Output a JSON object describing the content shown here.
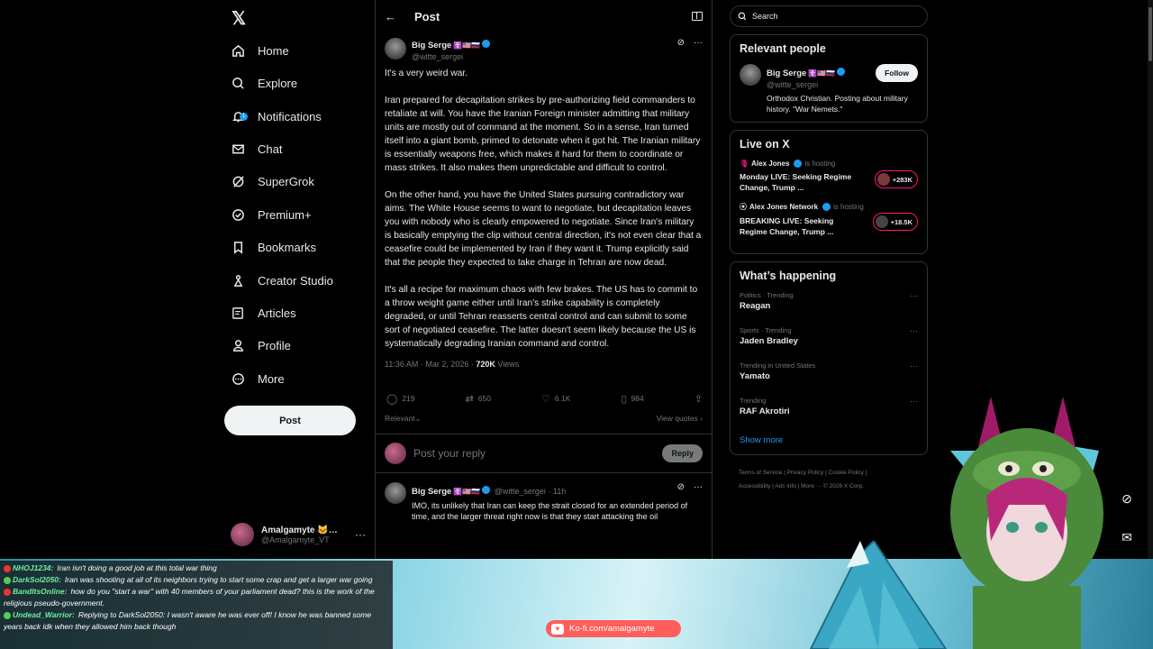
{
  "nav": {
    "logo": "𝕏",
    "items": [
      {
        "label": "Home",
        "icon": "home-icon"
      },
      {
        "label": "Explore",
        "icon": "search-icon"
      },
      {
        "label": "Notifications",
        "icon": "bell-icon"
      },
      {
        "label": "Chat",
        "icon": "mail-icon"
      },
      {
        "label": "SuperGrok",
        "icon": "grok-icon"
      },
      {
        "label": "Premium+",
        "icon": "premium-icon"
      },
      {
        "label": "Bookmarks",
        "icon": "bookmark-icon"
      },
      {
        "label": "Creator Studio",
        "icon": "creator-icon"
      },
      {
        "label": "Articles",
        "icon": "articles-icon"
      },
      {
        "label": "Profile",
        "icon": "person-icon"
      },
      {
        "label": "More",
        "icon": "more-circle-icon"
      }
    ],
    "notif_badge": "1",
    "post_label": "Post",
    "account": {
      "name": "Amalgamyte 🐱…",
      "handle": "@Amalgamyte_VT"
    }
  },
  "header": {
    "title": "Post"
  },
  "post": {
    "author": "Big Serge",
    "flags": "☦️🇺🇸🇷🇺",
    "handle": "@witte_sergei",
    "paragraphs": [
      "It's a very weird war.",
      "Iran prepared for decapitation strikes by pre-authorizing field commanders to retaliate at will. You have the Iranian Foreign minister admitting that military units are mostly out of command at the moment. So in a sense, Iran turned itself into a giant bomb, primed to detonate when it got hit. The Iranian military is essentially weapons free, which makes it hard for them to coordinate or mass strikes. It also makes them unpredictable and difficult to control.",
      "On the other hand, you have the United States pursuing contradictory war aims. The White House seems to want to negotiate, but decapitation leaves you with nobody who is clearly empowered to negotiate. Since Iran's military is basically emptying the clip without central direction, it's not even clear that a ceasefire could be implemented by Iran if they want it. Trump explicitly said that the people they expected to take charge in Tehran are now dead.",
      "It's all a recipe for maximum chaos with few brakes. The US has to commit to a throw weight game either until Iran's strike capability is completely degraded, or until Tehran reasserts central control and can submit to some sort of negotiated ceasefire. The latter doesn't seem likely because the US is systematically degrading Iranian command and control."
    ],
    "time": "11:36 AM · Mar 2, 2026 · ",
    "views_count": "720K",
    "views_label": " Views",
    "replies": "219",
    "reposts": "650",
    "likes": "6.1K",
    "bookmarks": "984",
    "relevant_label": "Relevant⌄",
    "view_quotes": "View quotes ›"
  },
  "reply_box": {
    "placeholder": "Post your reply",
    "button": "Reply"
  },
  "reply": {
    "author": "Big Serge",
    "flags": "☦️🇺🇸🇷🇺",
    "handle": "@witte_sergei · 11h",
    "text": "IMO, its unlikely that Iran can keep the strait closed for an extended period of time, and the larger threat right now is that they start attacking the oil"
  },
  "search": {
    "placeholder": "Search"
  },
  "relevant_people": {
    "title": "Relevant people",
    "name": "Big Serge",
    "flags": "☦️🇺🇸🇷🇺",
    "handle": "@witte_sergei",
    "follow": "Follow",
    "bio": "Orthodox Christian. Posting about military history. \"War Nemets.\""
  },
  "live": {
    "title": "Live on X",
    "items": [
      {
        "host": "Alex Jones",
        "suffix": "is hosting",
        "title": "Monday LIVE: Seeking Regime Change, Trump ...",
        "count": "+283K"
      },
      {
        "host": "Alex Jones Network",
        "suffix": "is hosting",
        "title": "BREAKING LIVE: Seeking Regime Change, Trump ...",
        "count": "+18.5K"
      }
    ]
  },
  "happening": {
    "title": "What’s happening",
    "trends": [
      {
        "cat": "Politics · Trending",
        "name": "Reagan"
      },
      {
        "cat": "Sports · Trending",
        "name": "Jaden Bradley"
      },
      {
        "cat": "Trending in United States",
        "name": "Yamato"
      },
      {
        "cat": "Trending",
        "name": "RAF Akrotiri"
      }
    ],
    "show_more": "Show more"
  },
  "footer": {
    "line1": "Terms of Service  |  Privacy Policy  |  Cookie Policy  |",
    "line2": "Accessibility  |  Ads info  |  More ···  © 2026 X Corp."
  },
  "chat": [
    {
      "user": "NHOJ1234:",
      "text": "Iran isn't doing a good job at this total war thing"
    },
    {
      "user": "DarkSol2050:",
      "text": "Iran was shooting at all of its neighbors trying to start some crap and get a larger war going"
    },
    {
      "user": "BandItsOnline:",
      "text": "how do you \"start a war\" with 40 members of your parliament dead? this is the work of the religious pseudo-government."
    },
    {
      "user": "Undead_Warrior:",
      "text": "Replying to DarkSol2050: I wasn't aware he was ever off! I know he was banned some years back idk when they allowed him back though"
    }
  ],
  "kofi": "Ko-fi.com/amalgamyte",
  "colors": {
    "accent": "#1d9bf0",
    "live": "#f91880",
    "kofi": "#ff5e5b"
  }
}
